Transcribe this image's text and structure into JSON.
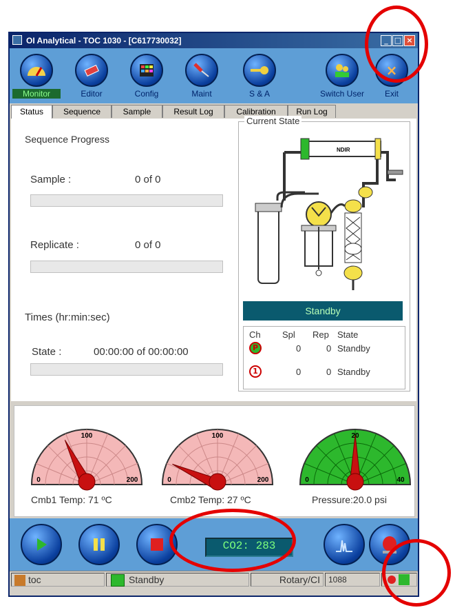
{
  "window": {
    "title": "OI Analytical - TOC 1030 - [C617730032]",
    "controls": [
      "minimize-icon",
      "maximize-icon",
      "close-icon"
    ]
  },
  "toolbar": {
    "items": [
      {
        "label": "Monitor",
        "icon": "gauge-icon",
        "active": true
      },
      {
        "label": "Editor",
        "icon": "eraser-icon",
        "active": false
      },
      {
        "label": "Config",
        "icon": "grid-icon",
        "active": false
      },
      {
        "label": "Maint",
        "icon": "screwdriver-icon",
        "active": false
      },
      {
        "label": "S & A",
        "icon": "key-icon",
        "active": false
      },
      {
        "label": "Switch User",
        "icon": "users-icon",
        "active": false
      },
      {
        "label": "Exit",
        "icon": "close-icon",
        "active": false
      }
    ]
  },
  "tabs": [
    "Status",
    "Sequence",
    "Sample",
    "Result Log",
    "Calibration",
    "Run Log"
  ],
  "active_tab": "Status",
  "sequence": {
    "title": "Sequence Progress",
    "sample_label": "Sample :",
    "sample_value": "0 of 0",
    "sample_progress": 0,
    "replicate_label": "Replicate :",
    "replicate_value": "0 of 0",
    "replicate_progress": 0,
    "times_title": "Times (hr:min:sec)",
    "state_label": "State :",
    "state_value": "00:00:00 of 00:00:00",
    "state_progress": 0
  },
  "current_state": {
    "title": "Current State",
    "ndir_label": "NDIR",
    "status": "Standby",
    "table": {
      "headers": [
        "Ch",
        "Spl",
        "Rep",
        "State"
      ],
      "rows": [
        {
          "icon": "p-channel-icon",
          "spl": "0",
          "rep": "0",
          "state": "Standby"
        },
        {
          "icon": "1-channel-icon",
          "spl": "0",
          "rep": "0",
          "state": "Standby"
        }
      ]
    }
  },
  "gauges": [
    {
      "caption": "Cmb1 Temp: 71 ºC",
      "min": "0",
      "mid": "100",
      "max": "200",
      "value": 71,
      "range": [
        0,
        200
      ],
      "face": "#f4b8b8",
      "grid": "#c88"
    },
    {
      "caption": "Cmb2 Temp: 27 ºC",
      "min": "0",
      "mid": "100",
      "max": "200",
      "value": 27,
      "range": [
        0,
        200
      ],
      "face": "#f4b8b8",
      "grid": "#c88"
    },
    {
      "caption": "Pressure:20.0 psi",
      "min": "0",
      "mid": "20",
      "max": "40",
      "value": 20,
      "range": [
        0,
        40
      ],
      "face": "#2db82d",
      "grid": "#0a6a0a"
    }
  ],
  "controls": {
    "co2": "CO2: 283",
    "buttons": [
      "play-icon",
      "pause-icon",
      "stop-icon",
      "peak-chart-icon",
      "alarm-icon"
    ]
  },
  "statusbar": {
    "user": "toc",
    "state": "Standby",
    "sampler": "Rotary/CI",
    "code": "1088"
  },
  "colors": {
    "toolbar": "#5e9ed6",
    "status_panel": "#0a5a6e",
    "status_text": "#b8ffb8",
    "annotation": "#e40000"
  }
}
